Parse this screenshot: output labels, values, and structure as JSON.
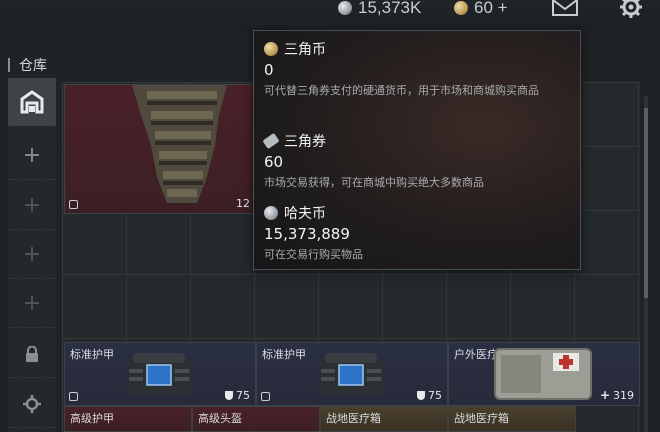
{
  "topbar": {
    "hafu_amount": "15,373K",
    "sanjiao_amount": "60 +",
    "icons": [
      "silver-coin-icon",
      "gold-coin-icon",
      "mail-icon",
      "settings-icon"
    ]
  },
  "warehouse": {
    "title": "仓库"
  },
  "sidebar": {
    "items": [
      {
        "icon": "warehouse-icon",
        "state": "active"
      },
      {
        "icon": "plus-icon",
        "state": "enabled"
      },
      {
        "icon": "plus-icon",
        "state": "dim"
      },
      {
        "icon": "plus-icon",
        "state": "dim"
      },
      {
        "icon": "plus-icon",
        "state": "dim"
      },
      {
        "icon": "lock-icon",
        "state": "locked"
      },
      {
        "icon": "gear-icon",
        "state": "enabled"
      }
    ]
  },
  "items": [
    {
      "name": "",
      "count": "12",
      "rarity": "red"
    },
    {
      "name": "标准护甲",
      "count": "75",
      "rarity": "blue"
    },
    {
      "name": "标准护甲",
      "count": "75",
      "rarity": "blue"
    },
    {
      "name": "户外医疗箱",
      "count": "319",
      "rarity": "blue"
    },
    {
      "name": "高级护甲",
      "count": "",
      "rarity": "red"
    },
    {
      "name": "高级头盔",
      "count": "",
      "rarity": "red"
    },
    {
      "name": "战地医疗箱",
      "count": "",
      "rarity": "gold"
    },
    {
      "name": "战地医疗箱",
      "count": "",
      "rarity": "gold"
    }
  ],
  "tooltip": {
    "sections": [
      {
        "icon": "gold-coin-icon",
        "name": "三角币",
        "value": "0",
        "desc": "可代替三角券支付的硬通货币，用于市场和商城购买商品"
      },
      {
        "icon": "ticket-icon",
        "name": "三角券",
        "value": "60",
        "desc": "市场交易获得，可在商城中购买绝大多数商品"
      },
      {
        "icon": "silver-coin-icon",
        "name": "哈夫币",
        "value": "15,373,889",
        "desc": "可在交易行购买物品"
      }
    ]
  },
  "colors": {
    "background": "#1f2326",
    "rarity_red": "#4a2128",
    "rarity_blue": "#2b2f43",
    "rarity_gold": "#4a3f2c",
    "tooltip_bg": "#211d1d"
  }
}
